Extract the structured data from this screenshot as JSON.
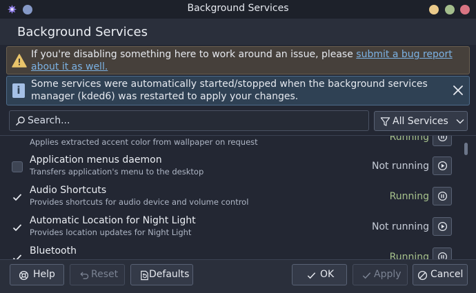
{
  "window": {
    "title": "Background Services"
  },
  "header": {
    "title": "Background Services"
  },
  "messages": {
    "warning": {
      "text_before": "If you're disabling something here to work around an issue, please ",
      "link": "submit a bug report about it as well."
    },
    "info": {
      "text": "Some services were automatically started/stopped when the background services manager (kded6) was restarted to apply your changes."
    }
  },
  "search": {
    "placeholder": "Search..."
  },
  "filter": {
    "selected": "All Services"
  },
  "services": [
    {
      "name": "",
      "description": "Applies extracted accent color from wallpaper on request",
      "status": "Running",
      "enabled": true
    },
    {
      "name": "Application menus daemon",
      "description": "Transfers application's menu to the desktop",
      "status": "Not running",
      "enabled": false
    },
    {
      "name": "Audio Shortcuts",
      "description": "Provides shortcuts for audio device and volume control",
      "status": "Running",
      "enabled": true
    },
    {
      "name": "Automatic Location for Night Light",
      "description": "Provides location updates for Night Light",
      "status": "Not running",
      "enabled": true
    },
    {
      "name": "Bluetooth",
      "description": "",
      "status": "Running",
      "enabled": true
    }
  ],
  "footer": {
    "help": "Help",
    "reset": "Reset",
    "defaults": "Defaults",
    "ok": "OK",
    "apply": "Apply",
    "cancel": "Cancel"
  },
  "colors": {
    "running": "#a6c18c",
    "not_running": "#c6ccd7",
    "link": "#7cb2e4",
    "warning_bg": "#46403b",
    "info_bg": "#2f4154"
  }
}
